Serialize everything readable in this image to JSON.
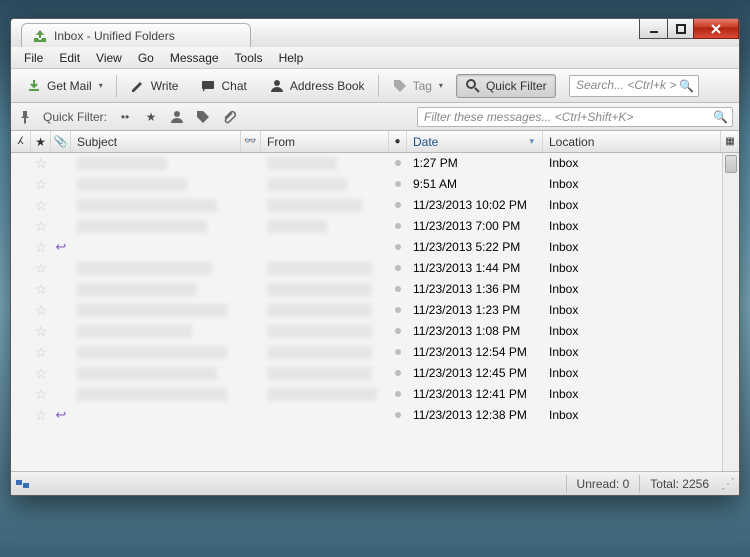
{
  "window": {
    "title": "Inbox - Unified Folders"
  },
  "menu": {
    "items": [
      "File",
      "Edit",
      "View",
      "Go",
      "Message",
      "Tools",
      "Help"
    ]
  },
  "toolbar": {
    "get_mail": "Get Mail",
    "write": "Write",
    "chat": "Chat",
    "address_book": "Address Book",
    "tag": "Tag",
    "quick_filter": "Quick Filter",
    "search_placeholder": "Search... <Ctrl+k >"
  },
  "quickfilter": {
    "label": "Quick Filter:",
    "filter_placeholder": "Filter these messages... <Ctrl+Shift+K>"
  },
  "columns": {
    "subject": "Subject",
    "from": "From",
    "date": "Date",
    "location": "Location"
  },
  "rows": [
    {
      "date": "1:27 PM",
      "location": "Inbox",
      "reply": false,
      "subj_w": 90,
      "from_w": 70
    },
    {
      "date": "9:51 AM",
      "location": "Inbox",
      "reply": false,
      "subj_w": 110,
      "from_w": 80
    },
    {
      "date": "11/23/2013 10:02 PM",
      "location": "Inbox",
      "reply": false,
      "subj_w": 140,
      "from_w": 95
    },
    {
      "date": "11/23/2013 7:00 PM",
      "location": "Inbox",
      "reply": false,
      "subj_w": 130,
      "from_w": 60
    },
    {
      "date": "11/23/2013 5:22 PM",
      "location": "Inbox",
      "reply": true,
      "subj_w": 0,
      "from_w": 0
    },
    {
      "date": "11/23/2013 1:44 PM",
      "location": "Inbox",
      "reply": false,
      "subj_w": 135,
      "from_w": 105
    },
    {
      "date": "11/23/2013 1:36 PM",
      "location": "Inbox",
      "reply": false,
      "subj_w": 120,
      "from_w": 105
    },
    {
      "date": "11/23/2013 1:23 PM",
      "location": "Inbox",
      "reply": false,
      "subj_w": 150,
      "from_w": 105
    },
    {
      "date": "11/23/2013 1:08 PM",
      "location": "Inbox",
      "reply": false,
      "subj_w": 115,
      "from_w": 105
    },
    {
      "date": "11/23/2013 12:54 PM",
      "location": "Inbox",
      "reply": false,
      "subj_w": 150,
      "from_w": 105
    },
    {
      "date": "11/23/2013 12:45 PM",
      "location": "Inbox",
      "reply": false,
      "subj_w": 140,
      "from_w": 105
    },
    {
      "date": "11/23/2013 12:41 PM",
      "location": "Inbox",
      "reply": false,
      "subj_w": 150,
      "from_w": 110
    },
    {
      "date": "11/23/2013 12:38 PM",
      "location": "Inbox",
      "reply": true,
      "subj_w": 0,
      "from_w": 0
    }
  ],
  "status": {
    "unread_label": "Unread:",
    "unread_value": "0",
    "total_label": "Total:",
    "total_value": "2256"
  }
}
